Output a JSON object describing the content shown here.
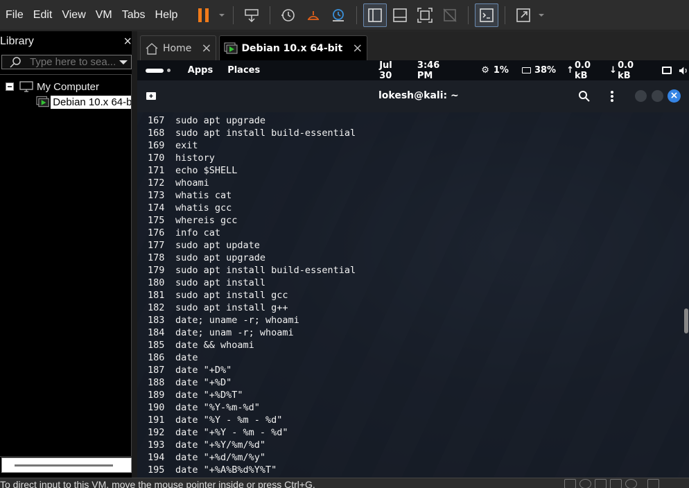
{
  "menu": {
    "items": [
      "File",
      "Edit",
      "View",
      "VM",
      "Tabs",
      "Help"
    ]
  },
  "library": {
    "title": "Library",
    "search_placeholder": "Type here to sea...",
    "tree": {
      "root": "My Computer",
      "child": "Debian 10.x 64-b"
    }
  },
  "tabs": [
    {
      "label": "Home"
    },
    {
      "label": "Debian 10.x 64-bit"
    }
  ],
  "gnome_bar": {
    "apps": "Apps",
    "places": "Places",
    "date": "Jul 30",
    "time": "3:46 PM",
    "cpu": "1%",
    "mem": "38%",
    "net_up": "0.0 kB",
    "net_down": "0.0 kB"
  },
  "terminal": {
    "title": "lokesh@kali: ~",
    "history": [
      {
        "n": "167",
        "cmd": "sudo apt upgrade"
      },
      {
        "n": "168",
        "cmd": "sudo apt install build-essential"
      },
      {
        "n": "169",
        "cmd": "exit"
      },
      {
        "n": "170",
        "cmd": "history"
      },
      {
        "n": "171",
        "cmd": "echo $SHELL"
      },
      {
        "n": "172",
        "cmd": "whoami"
      },
      {
        "n": "173",
        "cmd": "whatis cat"
      },
      {
        "n": "174",
        "cmd": "whatis gcc"
      },
      {
        "n": "175",
        "cmd": "whereis gcc"
      },
      {
        "n": "176",
        "cmd": "info cat"
      },
      {
        "n": "177",
        "cmd": "sudo apt update"
      },
      {
        "n": "178",
        "cmd": "sudo apt upgrade"
      },
      {
        "n": "179",
        "cmd": "sudo apt install build-essential"
      },
      {
        "n": "180",
        "cmd": "sudo apt install"
      },
      {
        "n": "181",
        "cmd": "sudo apt install gcc"
      },
      {
        "n": "182",
        "cmd": "sudo apt install g++"
      },
      {
        "n": "183",
        "cmd": "date; uname -r; whoami"
      },
      {
        "n": "184",
        "cmd": "date; unam -r; whoami"
      },
      {
        "n": "185",
        "cmd": "date && whoami"
      },
      {
        "n": "186",
        "cmd": "date"
      },
      {
        "n": "187",
        "cmd": "date \"+D%\""
      },
      {
        "n": "188",
        "cmd": "date \"+%D\""
      },
      {
        "n": "189",
        "cmd": "date \"+%D%T\""
      },
      {
        "n": "190",
        "cmd": "date \"%Y-%m-%d\""
      },
      {
        "n": "191",
        "cmd": "date \"%Y - %m - %d\""
      },
      {
        "n": "192",
        "cmd": "date \"+%Y - %m - %d\""
      },
      {
        "n": "193",
        "cmd": "date \"+%Y/%m/%d\""
      },
      {
        "n": "194",
        "cmd": "date \"+%d/%m/%y\""
      },
      {
        "n": "195",
        "cmd": "date \"+%A%B%d%Y%T\""
      }
    ]
  },
  "status": {
    "message": "To direct input to this VM, move the mouse pointer inside or press Ctrl+G."
  },
  "colors": {
    "accent": "#f07a1a",
    "close_blue": "#3584e4",
    "terminal_bg": "#1b1f26"
  }
}
